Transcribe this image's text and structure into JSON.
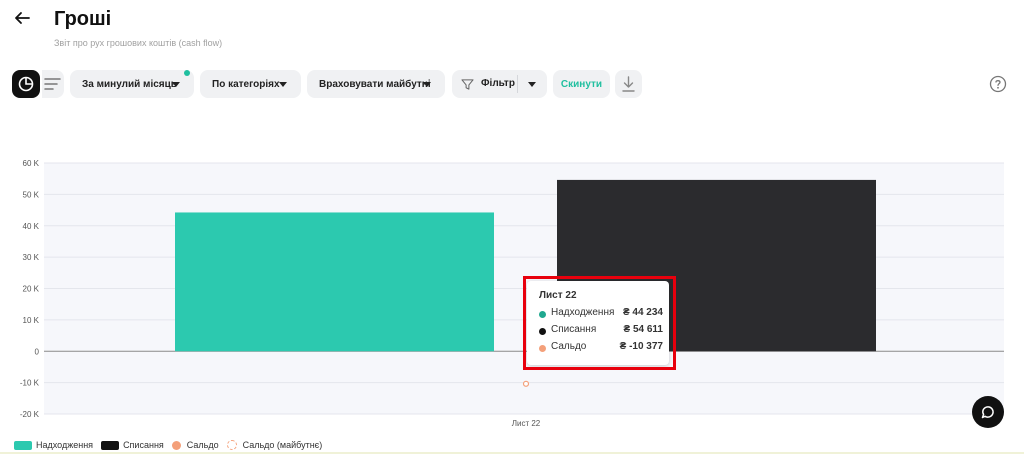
{
  "header": {
    "title": "Гроші",
    "subtitle": "Звіт про рух грошових коштів (cash flow)"
  },
  "toolbar": {
    "period_label": "За минулий місяць",
    "group_label": "По категоріях",
    "future_label": "Враховувати майбутні",
    "filter_label": "Фільтр",
    "reset_label": "Скинути",
    "accent_color": "#1fbf9f"
  },
  "chart_data": {
    "type": "bar",
    "categories": [
      "Лист 22"
    ],
    "series": [
      {
        "name": "Надходження",
        "values": [
          44234
        ],
        "color": "#2cc9af"
      },
      {
        "name": "Списання",
        "values": [
          54611
        ],
        "color": "#2b2b2e"
      },
      {
        "name": "Сальдо",
        "values": [
          -10377
        ],
        "color": "#f4a07a",
        "kind": "point"
      }
    ],
    "legend_extra": [
      "Сальдо (майбутнє)"
    ],
    "ylim": [
      -20000,
      60000
    ],
    "yticks": [
      {
        "value": 60000,
        "label": "60 K"
      },
      {
        "value": 50000,
        "label": "50 K"
      },
      {
        "value": 40000,
        "label": "40 K"
      },
      {
        "value": 30000,
        "label": "30 K"
      },
      {
        "value": 20000,
        "label": "20 K"
      },
      {
        "value": 10000,
        "label": "10 K"
      },
      {
        "value": 0,
        "label": "0"
      },
      {
        "value": -10000,
        "label": "-10 K"
      },
      {
        "value": -20000,
        "label": "-20 K"
      }
    ],
    "grid": true,
    "legend_position": "bottom-left"
  },
  "tooltip": {
    "title": "Лист 22",
    "rows": [
      {
        "name": "Надходження",
        "value": "₴ 44 234",
        "color": "#1fa88f"
      },
      {
        "name": "Списання",
        "value": "₴ 54 611",
        "color": "#111111"
      },
      {
        "name": "Сальдо",
        "value": "₴ -10 377",
        "color": "#f4a07a"
      }
    ]
  },
  "legend": {
    "items": [
      {
        "label": "Надходження",
        "color": "#2cc9af"
      },
      {
        "label": "Списання",
        "color": "#111111"
      },
      {
        "label": "Сальдо",
        "color": "#f4a07a"
      },
      {
        "label": "Сальдо (майбутнє)",
        "color": "#f4a07a"
      }
    ]
  }
}
